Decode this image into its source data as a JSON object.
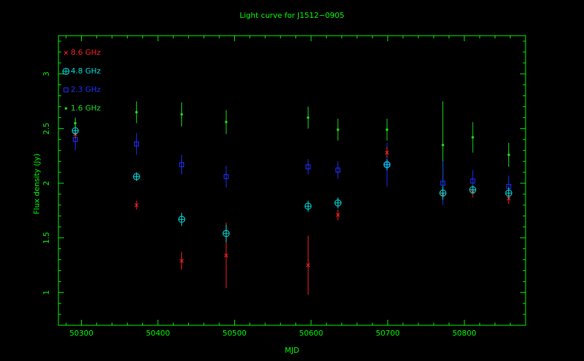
{
  "chart_data": {
    "type": "scatter",
    "title": "Light curve for J1512−0905",
    "xlabel": "MJD",
    "ylabel": "Flux density (Jy)",
    "xlim": [
      50270,
      50880
    ],
    "ylim": [
      0.7,
      3.35
    ],
    "xticks": [
      50300,
      50400,
      50500,
      50600,
      50700,
      50800
    ],
    "xtick_labels": [
      "50300",
      "50400",
      "50500",
      "50600",
      "50700",
      "50800"
    ],
    "yticks": [
      1,
      1.5,
      2,
      2.5,
      3
    ],
    "ytick_labels": [
      "1",
      "1.5",
      "2",
      "2.5",
      "3"
    ],
    "legend_position": "top-left",
    "grid": false,
    "colors": {
      "axes": "#00ff00",
      "title": "#00ff00"
    },
    "series": [
      {
        "name": "8.6 GHz",
        "marker": "cross",
        "color": "#ff2020",
        "points": [
          {
            "x": 50292,
            "y": 2.45,
            "err": 0.04
          },
          {
            "x": 50372,
            "y": 1.8,
            "err": 0.04
          },
          {
            "x": 50431,
            "y": 1.29,
            "err": 0.08
          },
          {
            "x": 50489,
            "y": 1.34,
            "err": 0.3
          },
          {
            "x": 50596,
            "y": 1.25,
            "err": 0.27
          },
          {
            "x": 50635,
            "y": 1.71,
            "err": 0.05
          },
          {
            "x": 50699,
            "y": 2.28,
            "err": 0.05
          },
          {
            "x": 50772,
            "y": 1.9,
            "err": 0.04
          },
          {
            "x": 50811,
            "y": 1.92,
            "err": 0.05
          },
          {
            "x": 50858,
            "y": 1.86,
            "err": 0.05
          }
        ]
      },
      {
        "name": "4.8 GHz",
        "marker": "circle-plus",
        "color": "#00e0e0",
        "points": [
          {
            "x": 50292,
            "y": 2.48,
            "err": 0.04
          },
          {
            "x": 50372,
            "y": 2.06,
            "err": 0.04
          },
          {
            "x": 50431,
            "y": 1.67,
            "err": 0.06
          },
          {
            "x": 50489,
            "y": 1.54,
            "err": 0.08
          },
          {
            "x": 50596,
            "y": 1.79,
            "err": 0.05
          },
          {
            "x": 50635,
            "y": 1.82,
            "err": 0.05
          },
          {
            "x": 50699,
            "y": 2.17,
            "err": 0.05
          },
          {
            "x": 50772,
            "y": 1.91,
            "err": 0.06
          },
          {
            "x": 50811,
            "y": 1.94,
            "err": 0.04
          },
          {
            "x": 50858,
            "y": 1.91,
            "err": 0.05
          }
        ]
      },
      {
        "name": "2.3 GHz",
        "marker": "square",
        "color": "#2030ff",
        "points": [
          {
            "x": 50292,
            "y": 2.4,
            "err": 0.1
          },
          {
            "x": 50372,
            "y": 2.36,
            "err": 0.1
          },
          {
            "x": 50431,
            "y": 2.17,
            "err": 0.09
          },
          {
            "x": 50489,
            "y": 2.06,
            "err": 0.1
          },
          {
            "x": 50596,
            "y": 2.15,
            "err": 0.07
          },
          {
            "x": 50635,
            "y": 2.12,
            "err": 0.08
          },
          {
            "x": 50699,
            "y": 2.17,
            "err": 0.2
          },
          {
            "x": 50772,
            "y": 2.0,
            "err": 0.2
          },
          {
            "x": 50811,
            "y": 2.02,
            "err": 0.1
          },
          {
            "x": 50858,
            "y": 1.97,
            "err": 0.1
          }
        ]
      },
      {
        "name": "1.6 GHz",
        "marker": "dot",
        "color": "#20e020",
        "points": [
          {
            "x": 50292,
            "y": 2.55,
            "err": 0.05
          },
          {
            "x": 50372,
            "y": 2.65,
            "err": 0.1
          },
          {
            "x": 50431,
            "y": 2.63,
            "err": 0.11
          },
          {
            "x": 50489,
            "y": 2.56,
            "err": 0.11
          },
          {
            "x": 50596,
            "y": 2.6,
            "err": 0.1
          },
          {
            "x": 50635,
            "y": 2.49,
            "err": 0.1
          },
          {
            "x": 50699,
            "y": 2.49,
            "err": 0.1
          },
          {
            "x": 50772,
            "y": 2.35,
            "err": 0.4
          },
          {
            "x": 50811,
            "y": 2.42,
            "err": 0.14
          },
          {
            "x": 50858,
            "y": 2.26,
            "err": 0.11
          }
        ]
      }
    ]
  }
}
